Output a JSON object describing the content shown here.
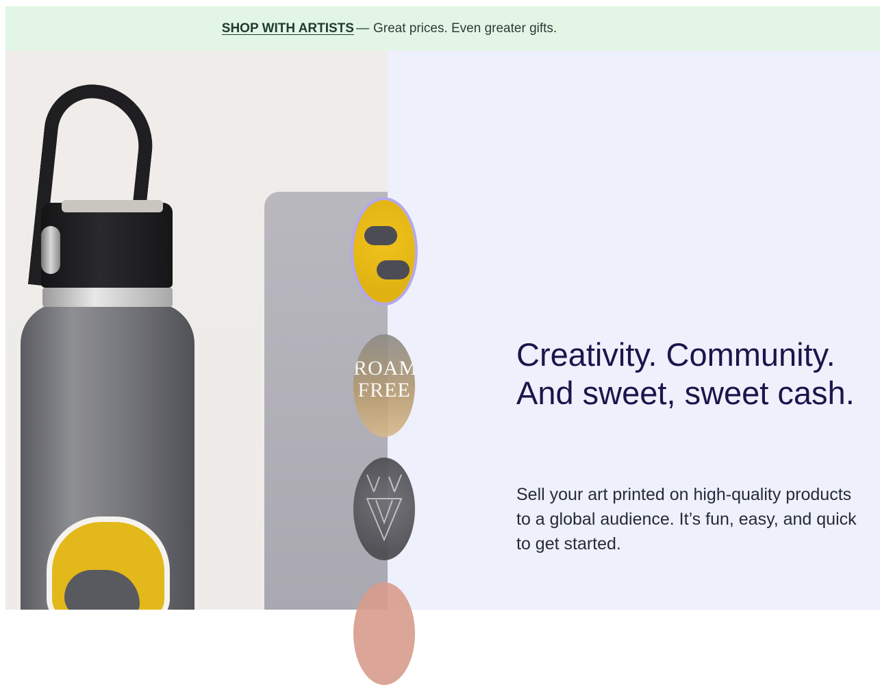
{
  "promo": {
    "link_label": "SHOP WITH ARTISTS",
    "dash": "—",
    "text": "Great prices. Even greater gifts."
  },
  "hero": {
    "headline_line1": "Creativity. Community.",
    "headline_line2": "And sweet, sweet cash.",
    "subtext": "Sell your art printed on high-quality products to a global audience. It’s fun, easy, and quick to get started."
  },
  "swatches": [
    {
      "name": "badger-floral",
      "color": "#e3b81b",
      "selected": true
    },
    {
      "name": "roam-free",
      "text": "ROAM FREE",
      "color": "#b59a70",
      "selected": false
    },
    {
      "name": "geometric-deer",
      "color": "#55555a",
      "selected": false
    },
    {
      "name": "pink-floral",
      "color": "#d79b8c",
      "selected": false
    }
  ],
  "colors": {
    "banner_bg": "#e3f6e6",
    "hero_right_bg": "#eef0fb",
    "headline": "#1a154b",
    "swatch_selected_ring": "#b4a7ee"
  }
}
